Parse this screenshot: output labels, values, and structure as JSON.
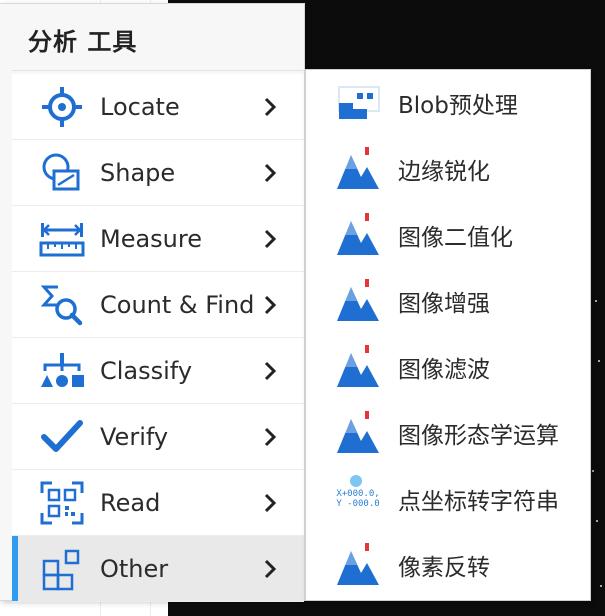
{
  "menu": {
    "title": "分析 工具",
    "items": [
      {
        "label": "Locate",
        "icon": "locate-icon"
      },
      {
        "label": "Shape",
        "icon": "shape-icon"
      },
      {
        "label": "Measure",
        "icon": "measure-icon"
      },
      {
        "label": "Count & Find",
        "icon": "count-find-icon"
      },
      {
        "label": "Classify",
        "icon": "classify-icon"
      },
      {
        "label": "Verify",
        "icon": "verify-check-icon"
      },
      {
        "label": "Read",
        "icon": "qr-code-icon"
      },
      {
        "label": "Other",
        "icon": "grid-blocks-icon",
        "active": true
      }
    ]
  },
  "submenu": {
    "items": [
      {
        "label": "Blob预处理",
        "icon": "blob-icon"
      },
      {
        "label": "边缘锐化",
        "icon": "image-tool-icon"
      },
      {
        "label": "图像二值化",
        "icon": "image-tool-icon"
      },
      {
        "label": "图像增强",
        "icon": "image-tool-icon"
      },
      {
        "label": "图像滤波",
        "icon": "image-tool-icon"
      },
      {
        "label": "图像形态学运算",
        "icon": "image-tool-icon"
      },
      {
        "label": "点坐标转字符串",
        "icon": "coordinate-icon",
        "icon_text": [
          "X+000.0,",
          "Y -000.0"
        ]
      },
      {
        "label": "像素反转",
        "icon": "image-tool-icon"
      }
    ]
  },
  "colors": {
    "accent": "#2f9cf0",
    "icon_blue": "#1e6fd1",
    "icon_red": "#e8343c"
  }
}
